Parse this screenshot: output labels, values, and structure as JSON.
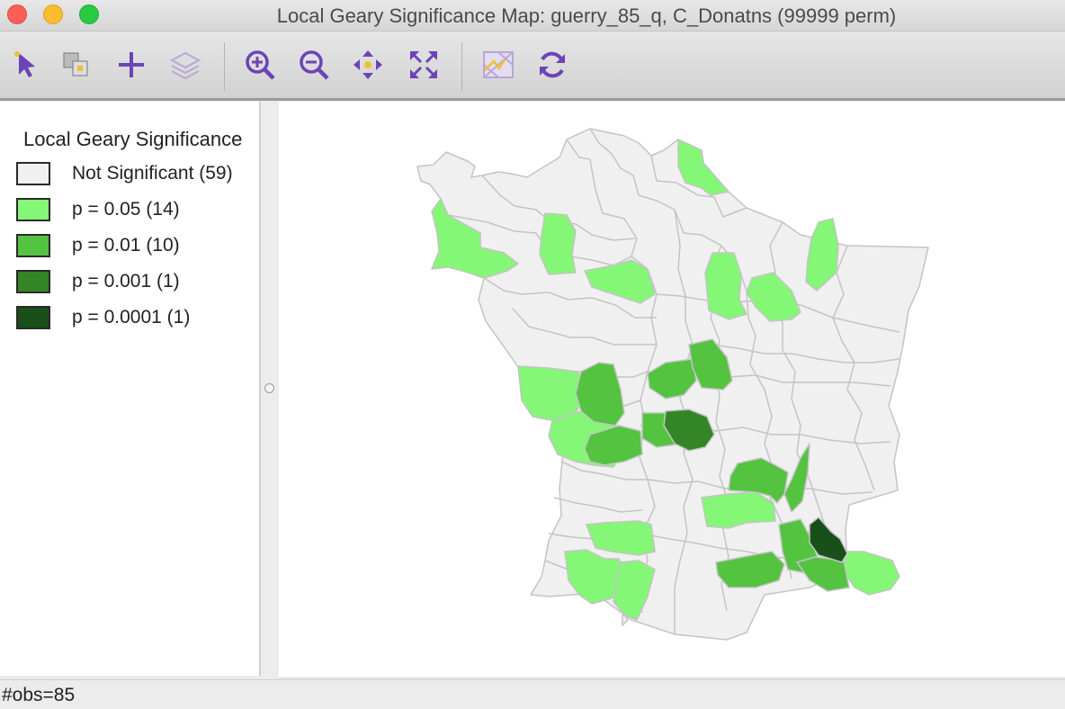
{
  "window": {
    "title": "Local Geary Significance Map: guerry_85_q, C_Donatns (99999 perm)"
  },
  "toolbar": {
    "items": [
      {
        "icon": "select-pointer-icon"
      },
      {
        "icon": "copy-image-icon"
      },
      {
        "icon": "add-plus-icon"
      },
      {
        "icon": "layers-icon"
      },
      {
        "icon": "zoom-in-icon"
      },
      {
        "icon": "zoom-out-icon"
      },
      {
        "icon": "pan-icon"
      },
      {
        "icon": "full-extent-icon"
      },
      {
        "icon": "basemap-icon"
      },
      {
        "icon": "refresh-icon"
      }
    ]
  },
  "legend": {
    "title": "Local Geary Significance",
    "items": [
      {
        "label": "Not Significant (59)",
        "color": "#f0f0f0"
      },
      {
        "label": "p = 0.05 (14)",
        "color": "#84f776"
      },
      {
        "label": "p = 0.01 (10)",
        "color": "#53c340"
      },
      {
        "label": "p = 0.001 (1)",
        "color": "#348526"
      },
      {
        "label": "p = 0.0001 (1)",
        "color": "#19501a"
      }
    ]
  },
  "map": {
    "outline_color": "#c4c4c4"
  },
  "status": {
    "text": "#obs=85"
  }
}
